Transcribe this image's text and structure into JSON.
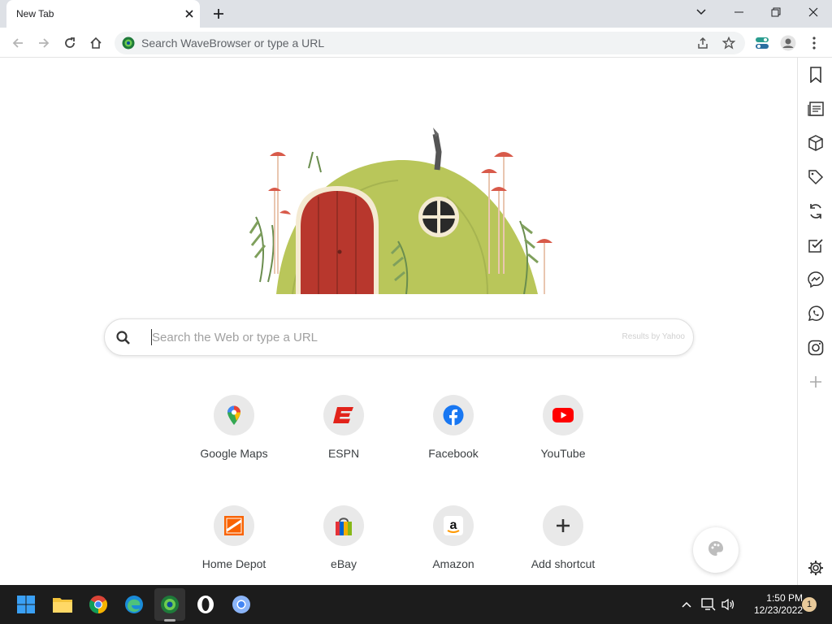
{
  "tab": {
    "title": "New Tab"
  },
  "omnibox": {
    "placeholder": "Search WaveBrowser or type a URL"
  },
  "search": {
    "placeholder": "Search the Web or type a URL",
    "provider": "Results by Yahoo"
  },
  "shortcuts": [
    {
      "label": "Google Maps",
      "icon": "google-maps-icon"
    },
    {
      "label": "ESPN",
      "icon": "espn-icon"
    },
    {
      "label": "Facebook",
      "icon": "facebook-icon"
    },
    {
      "label": "YouTube",
      "icon": "youtube-icon"
    },
    {
      "label": "Home Depot",
      "icon": "home-depot-icon"
    },
    {
      "label": "eBay",
      "icon": "ebay-icon"
    },
    {
      "label": "Amazon",
      "icon": "amazon-icon"
    },
    {
      "label": "Add shortcut",
      "icon": "plus-icon"
    }
  ],
  "sidepanel": [
    "bookmark-icon",
    "reading-list-icon",
    "box-icon",
    "tag-icon",
    "sync-icon",
    "checklist-icon",
    "messenger-icon",
    "whatsapp-icon",
    "instagram-icon",
    "add-icon",
    "settings-icon"
  ],
  "taskbar": {
    "time": "1:50 PM",
    "date": "12/23/2022",
    "notifications": "1"
  },
  "colors": {
    "tabbar": "#dee1e6",
    "taskbar": "#1c1c1c",
    "youtube": "#ff0000",
    "espn": "#e2231a",
    "facebook": "#1877f2",
    "homedepot": "#f96302"
  }
}
